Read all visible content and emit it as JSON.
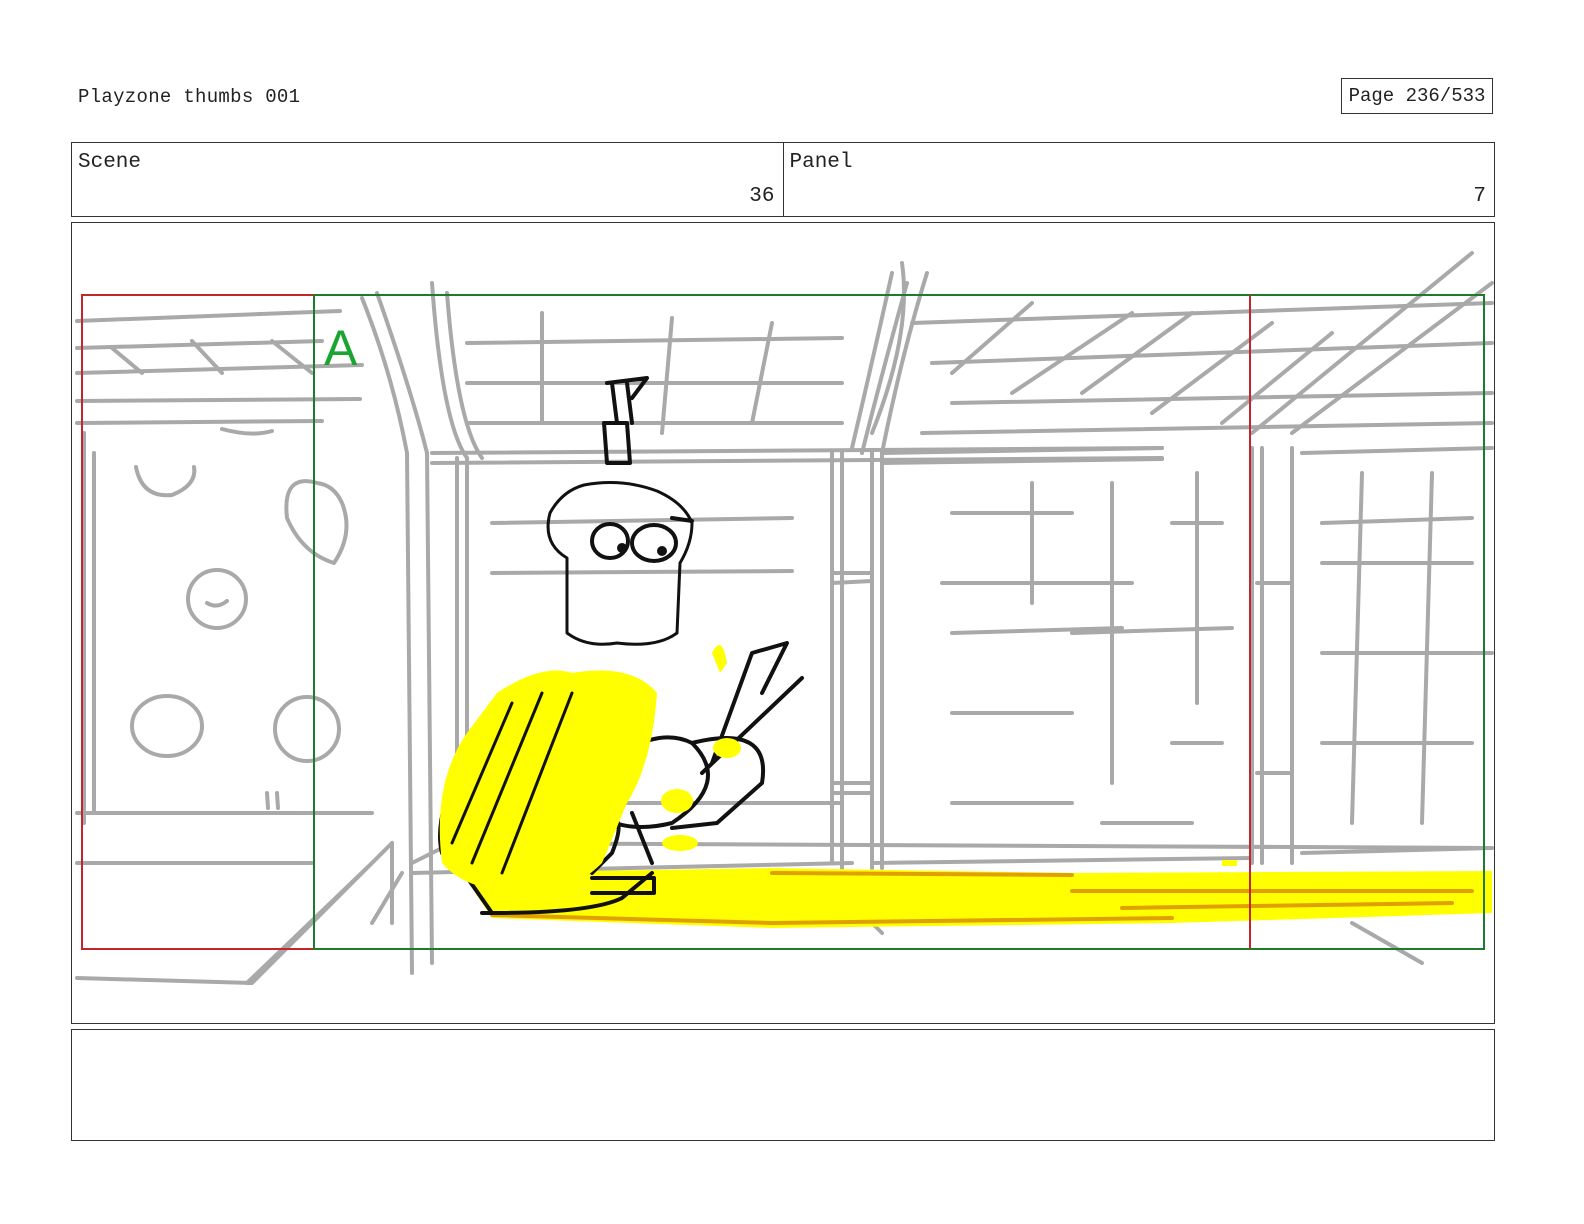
{
  "header": {
    "doc_title": "Playzone thumbs 001",
    "page_label": "Page 236/533"
  },
  "info": {
    "scene_label": "Scene",
    "scene_value": "36",
    "panel_label": "Panel",
    "panel_value": "7"
  },
  "frame": {
    "camera_label": "A",
    "colors": {
      "safe_frame": "#c0262c",
      "camera_frame": "#1f7a2b",
      "camera_label": "#1aa533",
      "sketch": "#a9a9a9",
      "ink": "#111111",
      "highlight": "#ffff00",
      "shadow": "#e0a000"
    }
  },
  "notes": {
    "text": ""
  }
}
